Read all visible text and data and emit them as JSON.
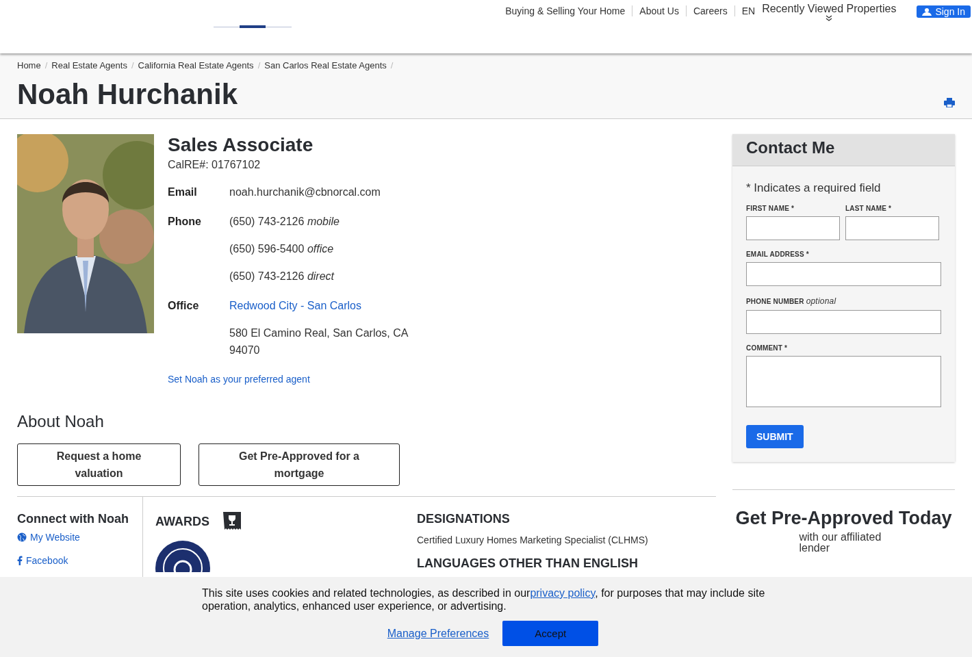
{
  "header": {
    "nav": [
      "Buying & Selling Your Home",
      "About Us",
      "Careers",
      "EN"
    ],
    "recently_viewed": "Recently Viewed Properties",
    "sign_in": "Sign In"
  },
  "breadcrumb": {
    "separator": "/",
    "items": [
      "Home",
      "Real Estate Agents",
      "California Real Estate Agents",
      "San Carlos Real Estate Agents"
    ]
  },
  "agent": {
    "name": "Noah Hurchanik",
    "title": "Sales Associate",
    "license": "CalRE#: 01767102",
    "details": [
      {
        "label": "Email",
        "lines": [
          {
            "kind": "text",
            "value": "noah.hurchanik@cbnorcal.com"
          }
        ]
      },
      {
        "label": "Phone",
        "lines": [
          {
            "kind": "phone",
            "value": "(650) 743-2126",
            "type": "mobile"
          },
          {
            "kind": "phone",
            "value": "(650) 596-5400",
            "type": "office"
          },
          {
            "kind": "phone",
            "value": "(650) 743-2126",
            "type": "direct"
          }
        ]
      },
      {
        "label": "Office",
        "lines": [
          {
            "kind": "link",
            "value": "Redwood City - San Carlos"
          },
          {
            "kind": "text",
            "value": "580 El Camino Real, San Carlos, CA 94070"
          }
        ]
      }
    ],
    "preferred_link": "Set Noah as your preferred agent"
  },
  "about": {
    "heading": "About Noah",
    "buttons": [
      "Request a home valuation",
      "Get Pre-Approved for a mortgage"
    ]
  },
  "connect": {
    "heading": "Connect with Noah",
    "links": [
      {
        "kind": "website",
        "label": "My Website"
      },
      {
        "kind": "facebook",
        "label": "Facebook"
      }
    ]
  },
  "awards": {
    "heading": "AWARDS"
  },
  "designations": {
    "heading": "DESIGNATIONS",
    "items": [
      "Certified Luxury Homes Marketing Specialist (CLHMS)"
    ]
  },
  "languages": {
    "heading": "LANGUAGES OTHER THAN ENGLISH"
  },
  "contact_form": {
    "title": "Contact Me",
    "required_note": "* Indicates a required field",
    "fields": [
      {
        "label": "FIRST NAME *",
        "kind": "input",
        "half": true
      },
      {
        "label": "LAST NAME *",
        "kind": "input",
        "half": true
      },
      {
        "label": "EMAIL ADDRESS *",
        "kind": "input",
        "half": false
      },
      {
        "label": "PHONE NUMBER",
        "note": "optional",
        "kind": "input",
        "half": false
      },
      {
        "label": "COMMENT *",
        "kind": "textarea",
        "half": false
      }
    ],
    "submit": "SUBMIT"
  },
  "promo": {
    "title": "Get Pre-Approved Today",
    "subtitle": "with our affiliated lender"
  },
  "cookie_banner": {
    "text": "This site uses cookies and related technologies, as described in our",
    "link": "privacy policy",
    "text_after": ", for purposes that may include site operation, analytics, enhanced user experience, or advertising.",
    "manage": "Manage Preferences",
    "accept": "Accept"
  }
}
